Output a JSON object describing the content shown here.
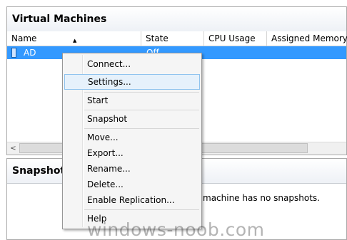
{
  "vm_panel": {
    "title": "Virtual Machines",
    "columns": [
      "Name",
      "State",
      "CPU Usage",
      "Assigned Memory"
    ],
    "rows": [
      {
        "name": "AD",
        "state": "Off"
      }
    ]
  },
  "snap_panel": {
    "title": "Snapshots",
    "message": "machine has no snapshots."
  },
  "context_menu": {
    "items": [
      {
        "label": "Connect...",
        "highlighted": false
      },
      {
        "label": "Settings...",
        "highlighted": true
      },
      {
        "label": "Start",
        "highlighted": false
      },
      {
        "label": "Snapshot",
        "highlighted": false
      },
      {
        "label": "Move...",
        "highlighted": false
      },
      {
        "label": "Export...",
        "highlighted": false
      },
      {
        "label": "Rename...",
        "highlighted": false
      },
      {
        "label": "Delete...",
        "highlighted": false
      },
      {
        "label": "Enable Replication...",
        "highlighted": false
      },
      {
        "label": "Help",
        "highlighted": false
      }
    ]
  },
  "colors": {
    "selection": "#3399ff",
    "menu_highlight": "#e6f1fb",
    "menu_highlight_border": "#8fc3ee"
  },
  "watermark": "windows-noob.com",
  "icons": {
    "vm": "virtual-machine-icon",
    "sort": "sort-ascending-icon",
    "scroll_left": "scroll-left-arrow-icon"
  }
}
